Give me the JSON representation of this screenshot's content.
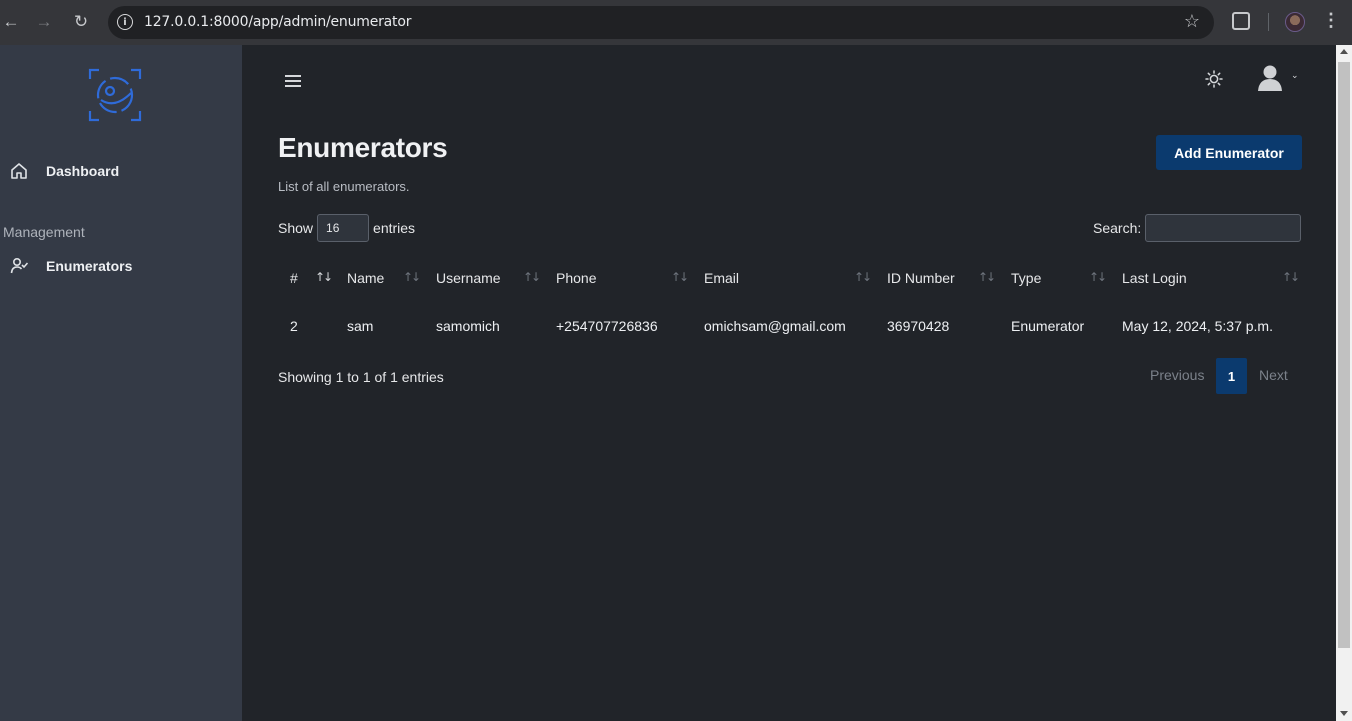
{
  "browser": {
    "url": "127.0.0.1:8000/app/admin/enumerator"
  },
  "sidebar": {
    "items": [
      {
        "label": "Dashboard",
        "icon": "home-icon"
      },
      {
        "label": "Enumerators",
        "icon": "user-check-icon"
      }
    ],
    "section_heading": "Management"
  },
  "header": {
    "theme_icon": "sun-icon",
    "user_icon": "user-avatar-icon"
  },
  "page": {
    "title": "Enumerators",
    "subtitle": "List of all enumerators.",
    "add_button_label": "Add Enumerator"
  },
  "table_controls": {
    "show_label": "Show",
    "entries_value": "16",
    "entries_label": "entries",
    "search_label": "Search:",
    "search_value": ""
  },
  "table": {
    "columns": [
      "#",
      "Name",
      "Username",
      "Phone",
      "Email",
      "ID Number",
      "Type",
      "Last Login"
    ],
    "rows": [
      [
        "2",
        "sam",
        "samomich",
        "+254707726836",
        "omichsam@gmail.com",
        "36970428",
        "Enumerator",
        "May 12, 2024, 5:37 p.m."
      ]
    ]
  },
  "footer": {
    "info": "Showing 1 to 1 of 1 entries",
    "previous_label": "Previous",
    "current_page": "1",
    "next_label": "Next"
  },
  "colors": {
    "sidebar_bg": "#343a46",
    "main_bg": "#212429",
    "accent": "#0b3a6e",
    "logo": "#2f6bd9"
  }
}
